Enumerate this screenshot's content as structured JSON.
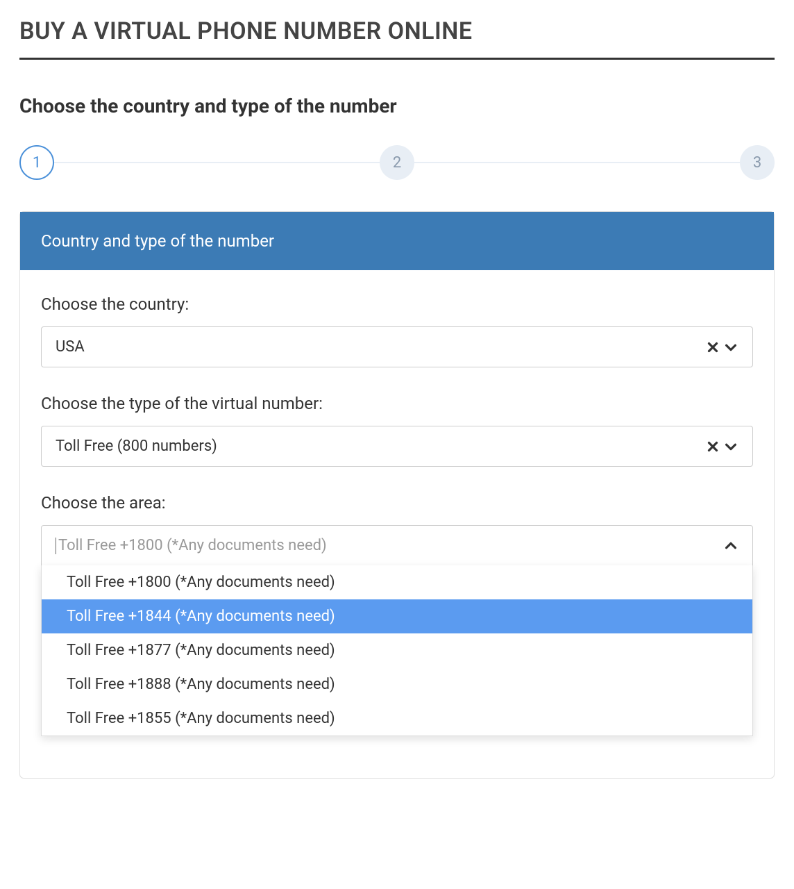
{
  "page": {
    "title": "BUY A VIRTUAL PHONE NUMBER ONLINE",
    "subtitle": "Choose the country and type of the number"
  },
  "stepper": {
    "steps": [
      "1",
      "2",
      "3"
    ],
    "active_index": 0
  },
  "card": {
    "header": "Country and type of the number"
  },
  "fields": {
    "country": {
      "label": "Choose the country:",
      "value": "USA"
    },
    "type": {
      "label": "Choose the type of the virtual number:",
      "value": "Toll Free (800 numbers)"
    },
    "area": {
      "label": "Choose the area:",
      "placeholder": "Toll Free +1800 (*Any documents need)",
      "open": true,
      "options": [
        {
          "label": "Toll Free +1800 (*Any documents need)",
          "highlighted": false
        },
        {
          "label": "Toll Free +1844 (*Any documents need)",
          "highlighted": true
        },
        {
          "label": "Toll Free +1877 (*Any documents need)",
          "highlighted": false
        },
        {
          "label": "Toll Free +1888 (*Any documents need)",
          "highlighted": false
        },
        {
          "label": "Toll Free +1855 (*Any documents need)",
          "highlighted": false
        }
      ]
    }
  },
  "icons": {
    "clear": "close-icon",
    "chevron_down": "chevron-down-icon",
    "chevron_up": "chevron-up-icon"
  }
}
